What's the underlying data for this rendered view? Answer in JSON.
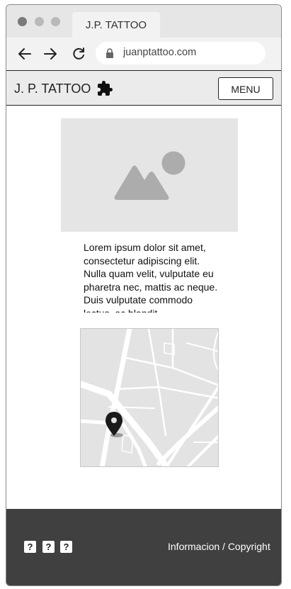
{
  "browser": {
    "tab_title": "J.P. TATTOO",
    "url": "juanptattoo.com",
    "icons": [
      "back-arrow-icon",
      "forward-arrow-icon",
      "reload-icon",
      "lock-icon"
    ]
  },
  "header": {
    "logo_text": "J. P. TATTOO",
    "logo_icon": "puzzle-icon",
    "menu_label": "MENU"
  },
  "main": {
    "image_placeholder_icon": "image-placeholder-icon",
    "paragraph": "Lorem ipsum dolor sit amet, consectetur adipiscing elit. Nulla quam velit, vulputate eu pharetra nec, mattis ac neque. Duis vulputate commodo lectus, ac blandit",
    "map_icon": "map-pin-icon"
  },
  "footer": {
    "social_icons": [
      "?",
      "?",
      "?"
    ],
    "link_text": "Informacion / Copyright"
  },
  "colors": {
    "footer_bg": "#404040",
    "header_bg": "#ebebeb",
    "placeholder": "#e5e5e5"
  }
}
